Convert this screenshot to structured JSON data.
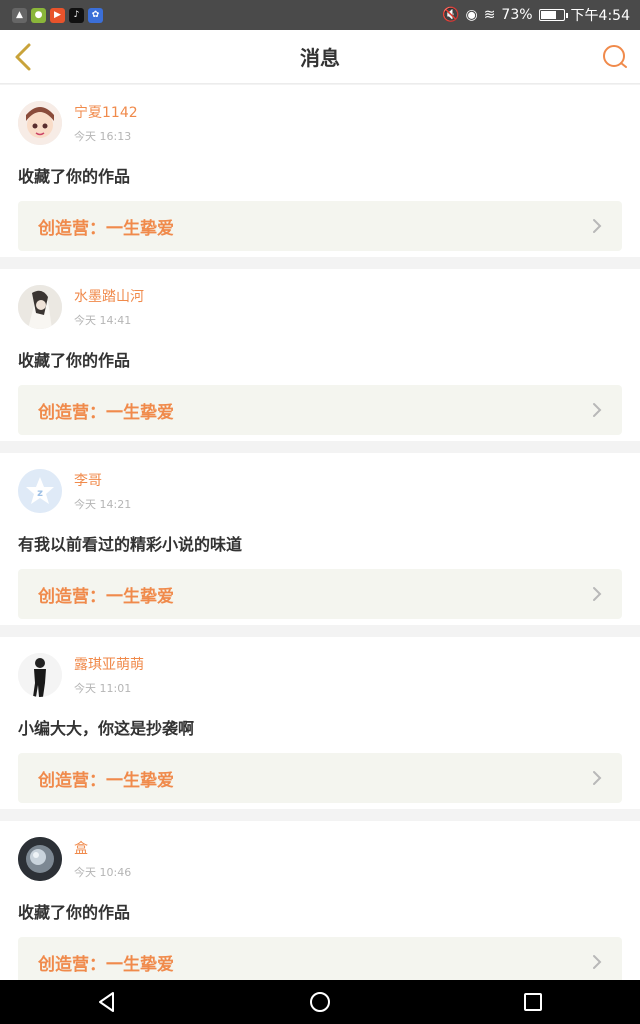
{
  "status_bar": {
    "battery_percent": "73%",
    "battery_level": 0.73,
    "time": "下午4:54",
    "icons": [
      "ticket-icon",
      "bilibili-like-icon",
      "video-app-icon",
      "tiktok-icon",
      "baidu-icon"
    ]
  },
  "header": {
    "title": "消息"
  },
  "messages": [
    {
      "user": "宁夏1142",
      "time": "今天 16:13",
      "comment": "收藏了你的作品",
      "work_label": "创造营：一生挚爱",
      "avatar": "anime-girl-avatar"
    },
    {
      "user": "水墨踏山河",
      "time": "今天 14:41",
      "comment": "收藏了你的作品",
      "work_label": "创造营：一生挚爱",
      "avatar": "ink-painting-avatar"
    },
    {
      "user": "李哥",
      "time": "今天 14:21",
      "comment": "有我以前看过的精彩小说的味道",
      "work_label": "创造营：一生挚爱",
      "avatar": "default-qq-avatar"
    },
    {
      "user": "露琪亚萌萌",
      "time": "今天 11:01",
      "comment": "小编大大，你这是抄袭啊",
      "work_label": "创造营：一生挚爱",
      "avatar": "figure-avatar"
    },
    {
      "user": "盒",
      "time": "今天 10:46",
      "comment": "收藏了你的作品",
      "work_label": "创造营：一生挚爱",
      "avatar": "photo-avatar"
    }
  ],
  "colors": {
    "accent": "#f08a4b",
    "link_bg": "#f4f5ef",
    "back_icon": "#c9a33a"
  }
}
